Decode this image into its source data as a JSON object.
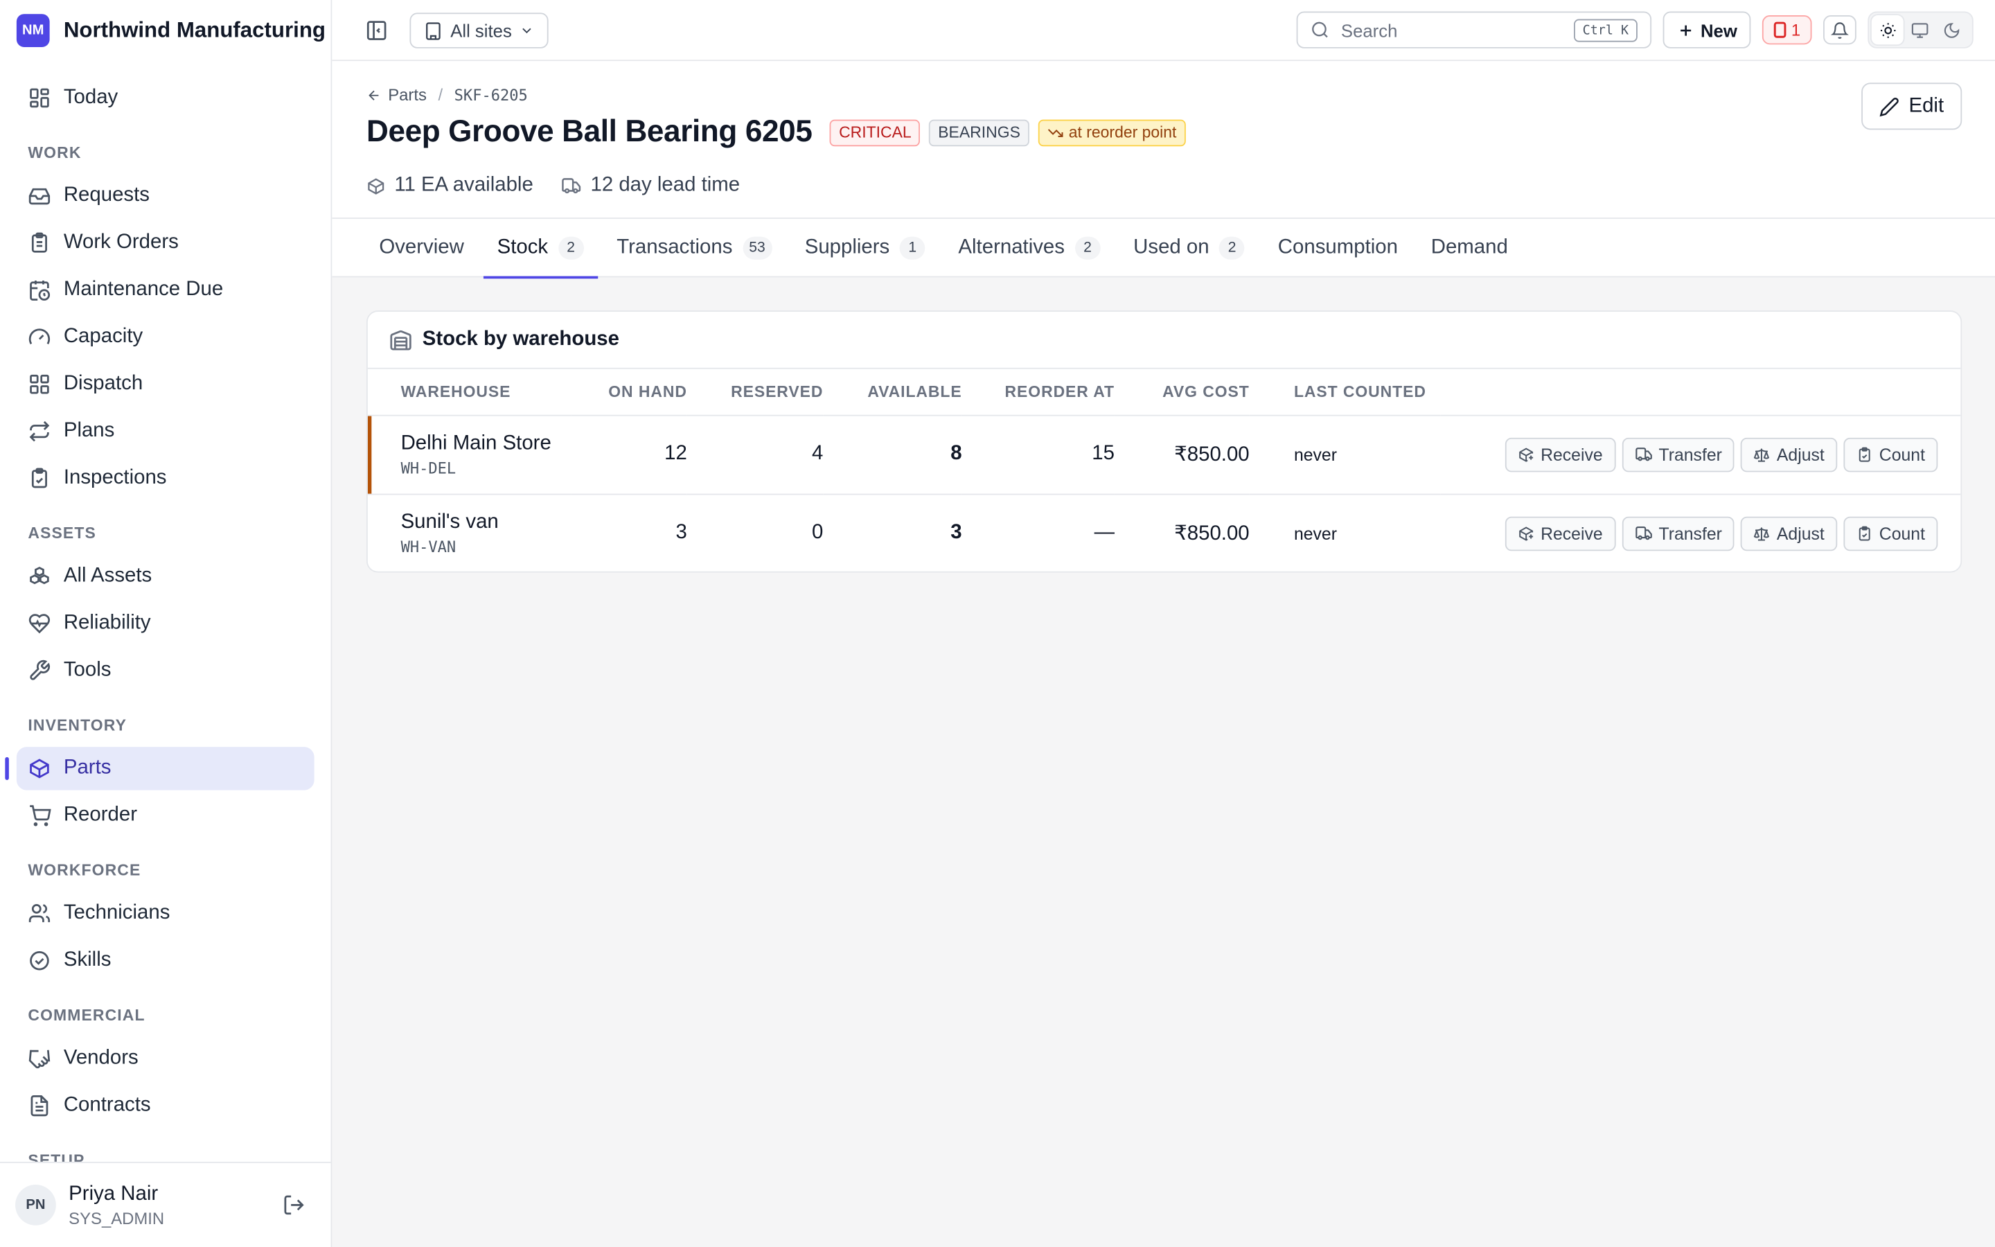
{
  "app": {
    "logo": "NM",
    "name": "Northwind Manufacturing"
  },
  "nav": {
    "today": "Today",
    "sections": {
      "work": "WORK",
      "assets": "ASSETS",
      "inventory": "INVENTORY",
      "workforce": "WORKFORCE",
      "commercial": "COMMERCIAL",
      "setup": "SETUP"
    },
    "work": [
      "Requests",
      "Work Orders",
      "Maintenance Due",
      "Capacity",
      "Dispatch",
      "Plans",
      "Inspections"
    ],
    "assets": [
      "All Assets",
      "Reliability",
      "Tools"
    ],
    "inventory": [
      "Parts",
      "Reorder"
    ],
    "workforce": [
      "Technicians",
      "Skills"
    ],
    "commercial": [
      "Vendors",
      "Contracts"
    ]
  },
  "user": {
    "initials": "PN",
    "name": "Priya Nair",
    "role": "SYS_ADMIN"
  },
  "topbar": {
    "site_selector": "All sites",
    "search_placeholder": "Search",
    "search_shortcut": "Ctrl K",
    "new_label": "New",
    "alert_count": "1"
  },
  "part": {
    "breadcrumb_parent": "Parts",
    "code": "SKF-6205",
    "title": "Deep Groove Ball Bearing 6205",
    "badges": {
      "criticality": "CRITICAL",
      "category": "BEARINGS",
      "status": "at reorder point"
    },
    "available": "11 EA available",
    "lead_time": "12 day lead time",
    "edit_label": "Edit"
  },
  "tabs": [
    {
      "label": "Overview",
      "count": ""
    },
    {
      "label": "Stock",
      "count": "2"
    },
    {
      "label": "Transactions",
      "count": "53"
    },
    {
      "label": "Suppliers",
      "count": "1"
    },
    {
      "label": "Alternatives",
      "count": "2"
    },
    {
      "label": "Used on",
      "count": "2"
    },
    {
      "label": "Consumption",
      "count": ""
    },
    {
      "label": "Demand",
      "count": ""
    }
  ],
  "stock": {
    "title": "Stock by warehouse",
    "columns": [
      "WAREHOUSE",
      "ON HAND",
      "RESERVED",
      "AVAILABLE",
      "REORDER AT",
      "AVG COST",
      "LAST COUNTED"
    ],
    "actions": [
      "Receive",
      "Transfer",
      "Adjust",
      "Count"
    ],
    "rows": [
      {
        "name": "Delhi Main Store",
        "code": "WH-DEL",
        "on_hand": "12",
        "reserved": "4",
        "available": "8",
        "reorder_at": "15",
        "avg_cost": "₹850.00",
        "last_counted": "never"
      },
      {
        "name": "Sunil's van",
        "code": "WH-VAN",
        "on_hand": "3",
        "reserved": "0",
        "available": "3",
        "reorder_at": "—",
        "avg_cost": "₹850.00",
        "last_counted": "never"
      }
    ]
  },
  "colors": {
    "accent": "#4f46e5",
    "critical": "#b91c1c",
    "warning": "#92400e",
    "low_stock_marker": "#b45309"
  }
}
